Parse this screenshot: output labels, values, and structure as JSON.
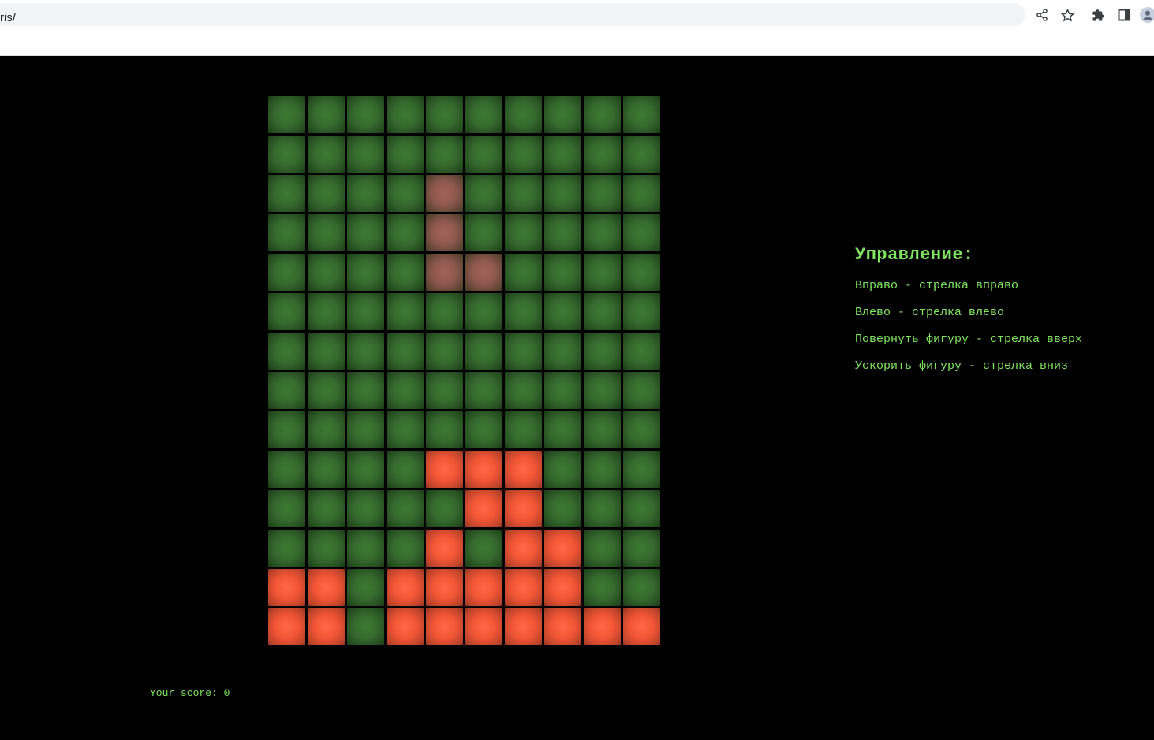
{
  "browser": {
    "url": "ris/"
  },
  "game": {
    "cols": 10,
    "rows": 14,
    "board": [
      "..........",
      "..........",
      "....a.....",
      "....a.....",
      "....aa....",
      "..........",
      "..........",
      "..........",
      "..........",
      "....fff...",
      ".....ff...",
      "....f.ff..",
      "ff.fffff..",
      "ff.fffffff"
    ]
  },
  "controls": {
    "title": "Управление:",
    "lines": [
      "Вправо - стрелка вправо",
      "Влево - стрелка влево",
      "Повернуть фигуру - стрелка вверх",
      "Ускорить фигуру - стрелка вниз"
    ]
  },
  "score": {
    "text": "Your score: 0"
  },
  "colors": {
    "background": "#000000",
    "empty_cell": "#356a2d",
    "filled_cell": "#f25535",
    "active_piece": "#8e584e",
    "text": "#7fe35f"
  }
}
